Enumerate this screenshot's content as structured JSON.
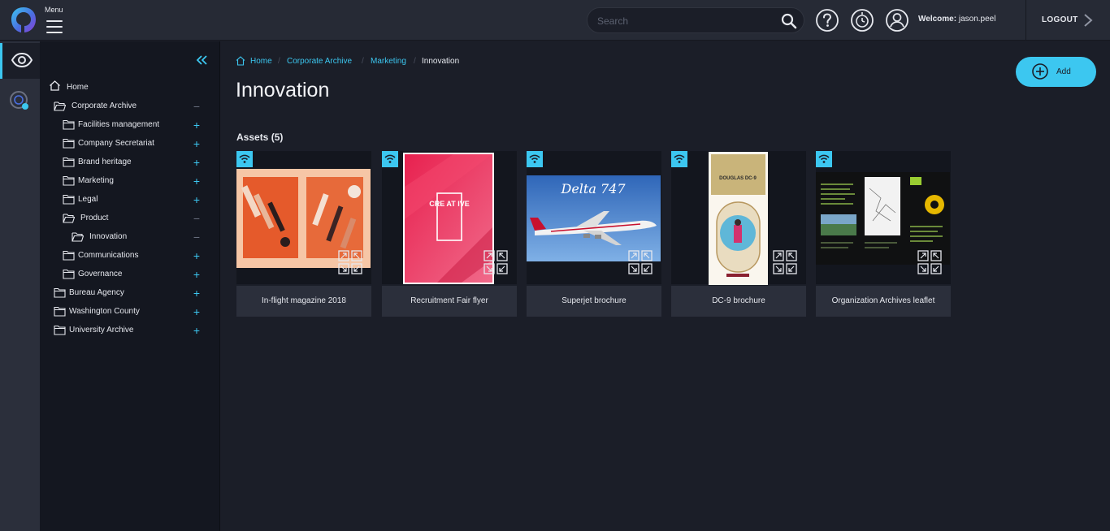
{
  "header": {
    "menu_label": "Menu",
    "search_placeholder": "Search",
    "welcome_prefix": "Welcome:",
    "username": "jason.peel",
    "logout_label": "LOGOUT",
    "accent_color": "#3cc7f0"
  },
  "rail": {
    "items": [
      {
        "icon": "eye-icon",
        "active": true
      },
      {
        "icon": "search-globe-icon",
        "active": false
      }
    ]
  },
  "tree": {
    "items": [
      {
        "label": "Home",
        "icon": "home-icon",
        "toggle": ""
      },
      {
        "label": "Corporate Archive",
        "icon": "folder-open-icon",
        "toggle": "−"
      },
      {
        "label": "Facilities management",
        "icon": "folder-icon",
        "toggle": "+"
      },
      {
        "label": "Company Secretariat",
        "icon": "folder-icon",
        "toggle": "+"
      },
      {
        "label": "Brand heritage",
        "icon": "folder-icon",
        "toggle": "+"
      },
      {
        "label": "Marketing",
        "icon": "folder-icon",
        "toggle": "+"
      },
      {
        "label": "Legal",
        "icon": "folder-icon",
        "toggle": "+"
      },
      {
        "label": "Product",
        "icon": "folder-open-icon",
        "toggle": "−"
      },
      {
        "label": "Innovation",
        "icon": "folder-open-icon",
        "toggle": "−"
      },
      {
        "label": "Communications",
        "icon": "folder-icon",
        "toggle": "+"
      },
      {
        "label": "Governance",
        "icon": "folder-icon",
        "toggle": "+"
      },
      {
        "label": "Bureau Agency",
        "icon": "folder-icon",
        "toggle": "+"
      },
      {
        "label": "Washington County",
        "icon": "folder-icon",
        "toggle": "+"
      },
      {
        "label": "University Archive",
        "icon": "folder-icon",
        "toggle": "+"
      }
    ]
  },
  "breadcrumb": {
    "items": [
      "Home",
      "Corporate Archive",
      "Marketing"
    ],
    "current": "Innovation"
  },
  "page": {
    "title": "Innovation",
    "add_label": "Add",
    "assets_heading": "Assets (5)"
  },
  "assets": [
    {
      "title": "In-flight magazine 2018"
    },
    {
      "title": "Recruitment Fair flyer",
      "thumb_text": "CRE AT IVE"
    },
    {
      "title": "Superjet brochure",
      "thumb_text": "Delta 747"
    },
    {
      "title": "DC-9 brochure",
      "thumb_text": "DOUGLAS DC-9"
    },
    {
      "title": "Organization Archives leaflet"
    }
  ]
}
